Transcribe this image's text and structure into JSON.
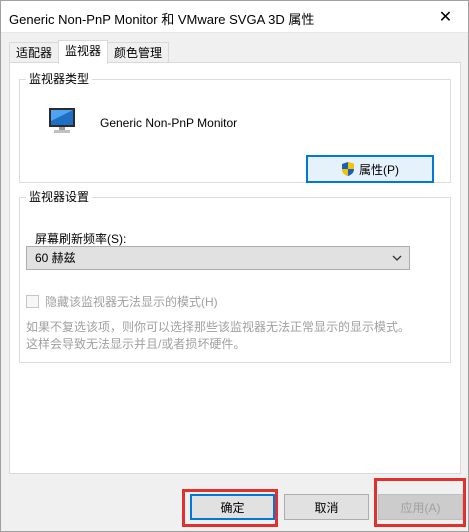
{
  "window": {
    "title": "Generic Non-PnP Monitor 和 VMware SVGA 3D 属性",
    "close_glyph": "✕"
  },
  "tabs": [
    {
      "label": "适配器",
      "active": false
    },
    {
      "label": "监视器",
      "active": true
    },
    {
      "label": "颜色管理",
      "active": false
    }
  ],
  "monitor_type": {
    "group_label": "监视器类型",
    "monitor_name": "Generic Non-PnP Monitor",
    "properties_button": "属性(P)",
    "icon": "monitor-icon"
  },
  "monitor_settings": {
    "group_label": "监视器设置",
    "refresh_label": "屏幕刷新频率(S):",
    "refresh_value": "60 赫兹",
    "hide_modes_checkbox_label": "隐藏该监视器无法显示的模式(H)",
    "hide_modes_checked": false,
    "description_line1": "如果不复选该项，则你可以选择那些该监视器无法正常显示的显示模式。",
    "description_line2": "这样会导致无法显示并且/或者损坏硬件。"
  },
  "buttons": {
    "ok": "确定",
    "cancel": "取消",
    "apply": "应用(A)"
  },
  "colors": {
    "accent": "#0078d7",
    "highlight": "#e0312f"
  }
}
